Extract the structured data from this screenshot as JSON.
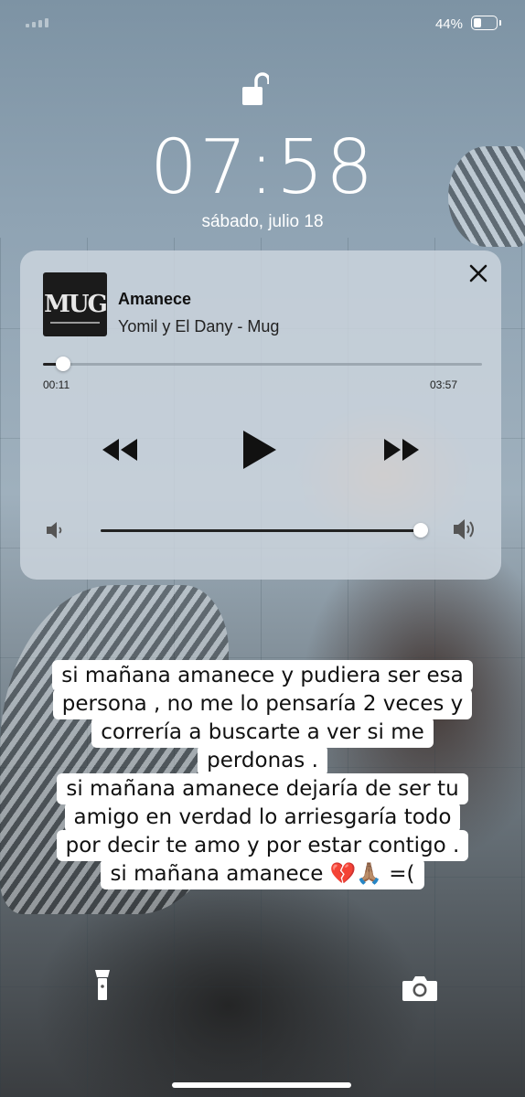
{
  "status_bar": {
    "battery_pct": "44%",
    "battery_level": 0.44,
    "signal_bars": 4
  },
  "lock_screen": {
    "time": "07:58",
    "date": "sábado, julio 18"
  },
  "player": {
    "album_art_text": "MUG",
    "track_title": "Amanece",
    "track_subtitle": "Yomil y El Dany - Mug",
    "elapsed": "00:11",
    "total": "03:57",
    "progress": 0.046,
    "volume": 1.0
  },
  "caption": {
    "lines": [
      "si mañana amanece y pudiera ser esa",
      "persona , no me lo pensaría 2 veces y",
      "correría a buscarte a ver si me",
      "perdonas .",
      "si mañana amanece dejaría de ser tu",
      "amigo en verdad lo arriesgaría todo",
      "por decir te amo y por estar contigo .",
      "si mañana amanece 💔🙏🏽 =("
    ]
  },
  "icons": {
    "lock": "unlocked-padlock-icon",
    "close": "close-icon",
    "rewind": "rewind-icon",
    "play": "play-icon",
    "forward": "fast-forward-icon",
    "volume_low": "volume-low-icon",
    "volume_high": "volume-high-icon",
    "flashlight": "flashlight-icon",
    "camera": "camera-icon"
  }
}
